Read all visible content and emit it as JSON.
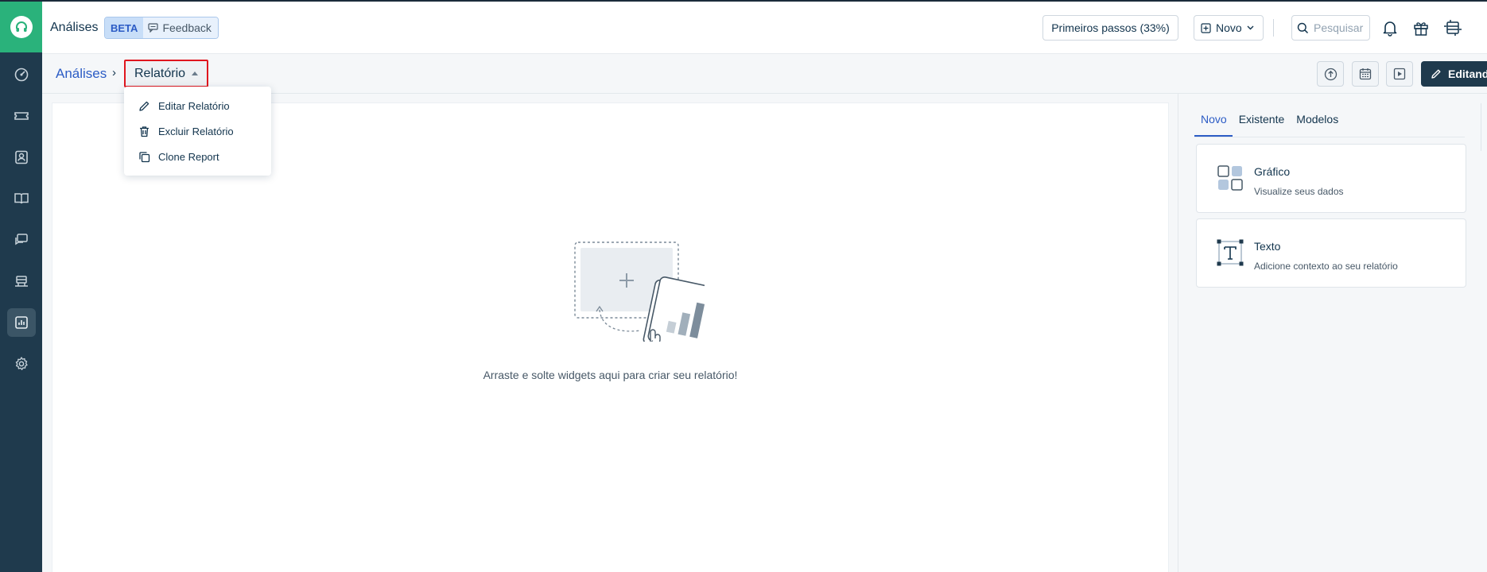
{
  "header": {
    "title": "Análises",
    "beta_label": "BETA",
    "feedback_label": "Feedback",
    "first_steps_label": "Primeiros passos (33%)",
    "new_label": "Novo",
    "search_placeholder": "Pesquisar"
  },
  "breadcrumb": {
    "parent": "Análises",
    "separator": "›",
    "current": "Relatório"
  },
  "dropdown": {
    "items": [
      {
        "label": "Editar Relatório",
        "icon": "pencil-icon"
      },
      {
        "label": "Excluir Relatório",
        "icon": "trash-icon"
      },
      {
        "label": "Clone Report",
        "icon": "copy-icon"
      }
    ]
  },
  "toolbar": {
    "edit_label": "Editando"
  },
  "canvas": {
    "empty_message": "Arraste e solte widgets aqui para criar seu relatório!"
  },
  "panel": {
    "tabs": [
      "Novo",
      "Existente",
      "Modelos"
    ],
    "active_tab": "Novo",
    "widgets": [
      {
        "title": "Gráfico",
        "subtitle": "Visualize seus dados",
        "icon": "chart-widget-icon"
      },
      {
        "title": "Texto",
        "subtitle": "Adicione contexto ao seu relatório",
        "icon": "text-widget-icon"
      }
    ]
  },
  "colors": {
    "accent": "#2c5cc5",
    "rail": "#1f3a4d",
    "logo": "#2ab27b",
    "highlight_border": "#e0161e"
  }
}
